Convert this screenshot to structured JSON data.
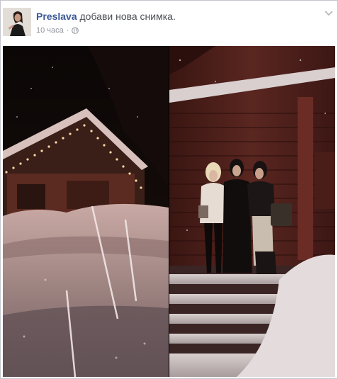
{
  "post": {
    "author": "Preslava",
    "action": "добави нова снимка.",
    "time": "10 часа",
    "separator": "·",
    "privacy_icon": "globe-icon",
    "menu_icon": "chevron-down-icon"
  },
  "colors": {
    "link": "#3b5998",
    "text": "#4b4f56",
    "meta": "#90949c"
  }
}
